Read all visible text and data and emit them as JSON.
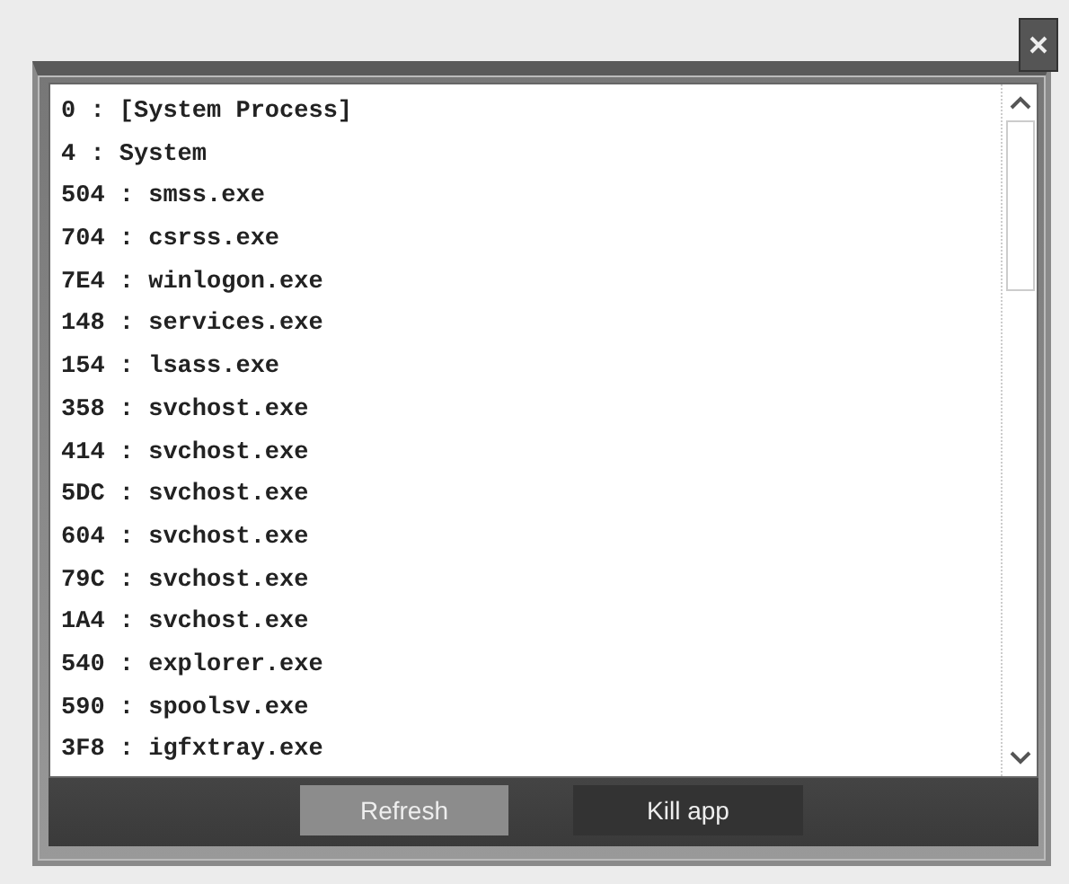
{
  "processes": [
    "0 : [System Process]",
    "4 : System",
    "504 : smss.exe",
    "704 : csrss.exe",
    "7E4 : winlogon.exe",
    "148 : services.exe",
    "154 : lsass.exe",
    "358 : svchost.exe",
    "414 : svchost.exe",
    "5DC : svchost.exe",
    "604 : svchost.exe",
    "79C : svchost.exe",
    "1A4 : svchost.exe",
    "540 : explorer.exe",
    "590 : spoolsv.exe",
    "3F8 : igfxtray.exe"
  ],
  "buttons": [
    {
      "label": "Refresh",
      "highlighted": true
    },
    {
      "label": "Kill app",
      "highlighted": false
    }
  ]
}
